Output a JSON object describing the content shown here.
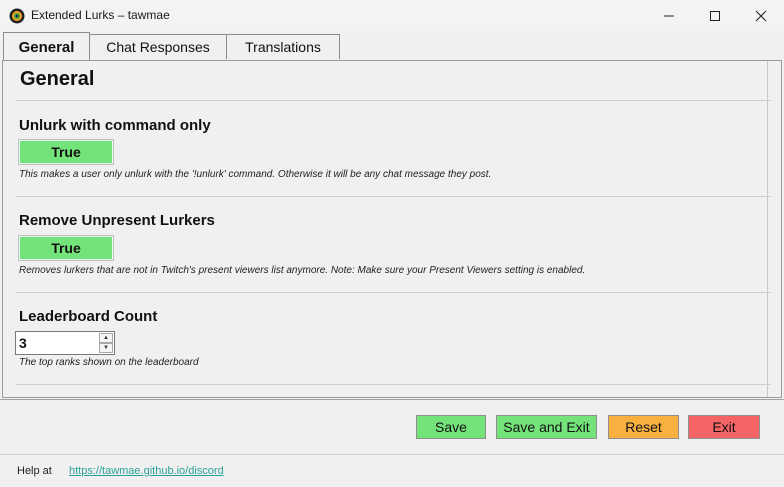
{
  "window": {
    "title": "Extended Lurks – tawmae",
    "minimize_glyph": "—",
    "maximize_glyph": "☐",
    "close_glyph": "✕"
  },
  "tabs": [
    {
      "label": "General",
      "active": true
    },
    {
      "label": "Chat Responses",
      "active": false
    },
    {
      "label": "Translations",
      "active": false
    }
  ],
  "panel": {
    "title": "General",
    "settings": [
      {
        "label": "Unlurk with command only",
        "value": "True",
        "description": "This makes a user only unlurk with the '!unlurk' command. Otherwise it will be any chat message they post."
      },
      {
        "label": "Remove Unpresent Lurkers",
        "value": "True",
        "description": "Removes lurkers that are not in Twitch's present viewers list anymore. Note: Make sure your Present Viewers setting is enabled."
      },
      {
        "label": "Leaderboard Count",
        "value": "3",
        "description": "The top ranks shown on the leaderboard"
      }
    ]
  },
  "buttons": {
    "save": "Save",
    "save_and_exit": "Save and Exit",
    "reset": "Reset",
    "exit": "Exit"
  },
  "footer": {
    "help_label": "Help at",
    "help_link": "https://tawmae.github.io/discord"
  },
  "colors": {
    "true_green": "#74e37a",
    "reset_orange": "#f8b13f",
    "exit_red": "#f46464",
    "link_teal": "#2aa198"
  },
  "icons": {
    "app": "app-logo-icon",
    "spin_up": "spin-up-icon",
    "spin_down": "spin-down-icon"
  }
}
